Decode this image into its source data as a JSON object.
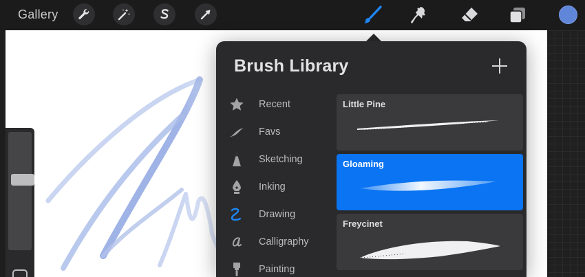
{
  "toolbar": {
    "gallery_label": "Gallery",
    "left_tools": [
      "wrench-icon",
      "magic-wand-icon",
      "selection-s-icon",
      "transform-arrow-icon"
    ],
    "right_tools": [
      "brush-icon",
      "smudge-icon",
      "eraser-icon",
      "layers-icon"
    ],
    "active_tool": "brush-icon",
    "active_color": "#5f86d8",
    "accent": "#1e86f7"
  },
  "brush_library": {
    "title": "Brush Library",
    "categories": [
      {
        "label": "Recent",
        "icon": "star-icon"
      },
      {
        "label": "Favs",
        "icon": "leaf-icon"
      },
      {
        "label": "Sketching",
        "icon": "pencil-icon"
      },
      {
        "label": "Inking",
        "icon": "pen-nib-icon"
      },
      {
        "label": "Drawing",
        "icon": "squiggle-icon",
        "active": true
      },
      {
        "label": "Calligraphy",
        "icon": "script-a-icon"
      },
      {
        "label": "Painting",
        "icon": "paintbrush-icon"
      }
    ],
    "brushes": [
      {
        "name": "Little Pine",
        "selected": false
      },
      {
        "name": "Gloaming",
        "selected": true
      },
      {
        "name": "Freycinet",
        "selected": false
      }
    ]
  }
}
